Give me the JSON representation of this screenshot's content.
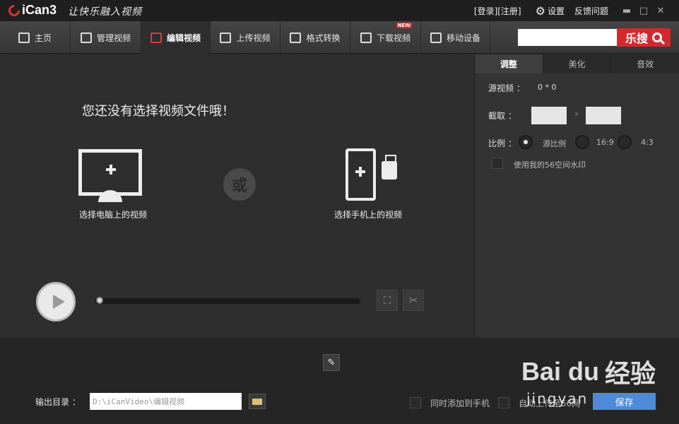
{
  "titlebar": {
    "app_name": "iCan3",
    "slogan": "让快乐融入视频",
    "login_register": "[登录][注册]",
    "settings": "设置",
    "feedback": "反馈问题"
  },
  "nav": {
    "items": [
      {
        "label": "主页",
        "icon": "home-icon"
      },
      {
        "label": "管理视频",
        "icon": "manage-video-icon"
      },
      {
        "label": "编辑视频",
        "icon": "edit-video-icon",
        "active": true
      },
      {
        "label": "上传视频",
        "icon": "upload-icon"
      },
      {
        "label": "格式转换",
        "icon": "convert-icon"
      },
      {
        "label": "下载视频",
        "icon": "download-icon",
        "badge": "NEW"
      },
      {
        "label": "移动设备",
        "icon": "mobile-device-icon"
      }
    ],
    "search_placeholder": "",
    "search_button": "乐搜"
  },
  "preview": {
    "prompt": "您还没有选择视频文件哦！",
    "pc_label": "选择电脑上的视频",
    "or_label": "或",
    "phone_label": "选择手机上的视频"
  },
  "panel": {
    "tabs": [
      "调整",
      "美化",
      "音效"
    ],
    "source_label": "源视频 ：",
    "source_value": "0 * 0",
    "crop_label": "截取 ：",
    "crop_sep": "x",
    "ratio_label": "比例 ：",
    "ratio_options": [
      "源比例",
      "16:9",
      "4:3"
    ],
    "watermark_label": "使用我的56空间水印"
  },
  "bottom": {
    "output_label": "输出目录 ：",
    "output_path": "D:\\iCanVideo\\编辑视频",
    "sync_phone": "同时添加到手机",
    "option2": "自动上传至56网",
    "save": "保存"
  },
  "watermark": {
    "brand": "Bai du",
    "sub": "jingyan",
    "cn": "经验"
  },
  "colors": {
    "accent_red": "#d5282c",
    "save_blue": "#4e8ad8"
  }
}
